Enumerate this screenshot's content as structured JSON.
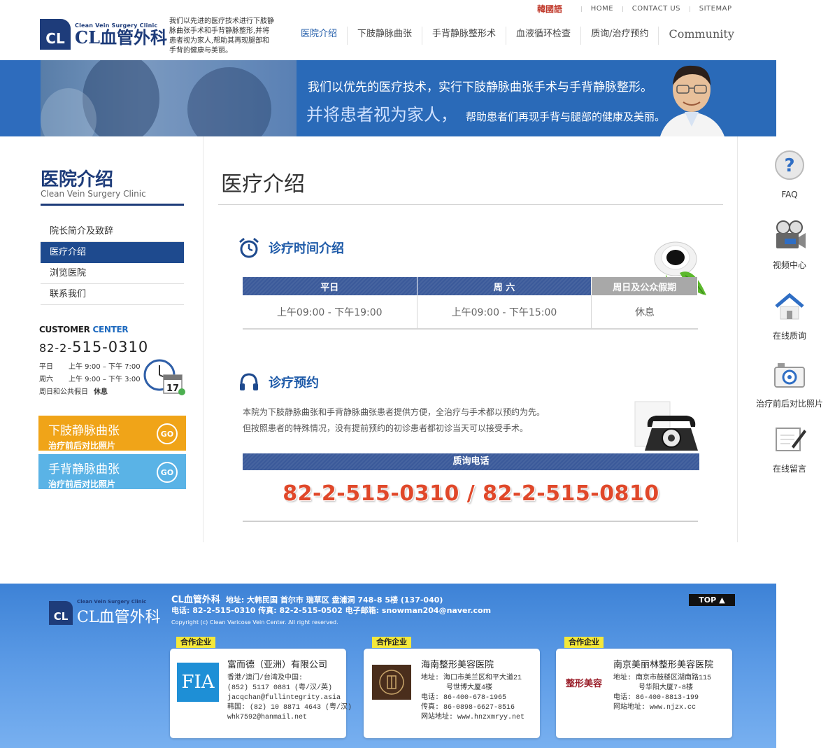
{
  "util": {
    "korean": "韓國語",
    "home": "HOME",
    "contact": "CONTACT US",
    "sitemap": "SITEMAP"
  },
  "logo": {
    "badge": "CL",
    "en": "Clean Vein Surgery Clinic",
    "cn": "CL血管外科",
    "desc": "我们以先进的医疗技术进行下肢静脉曲张手术和手背静脉整形,并将患者视为家人,帮助其再现腿部和手背的健康与美丽。"
  },
  "nav": [
    "医院介绍",
    "下肢静脉曲张",
    "手背静脉整形术",
    "血液循环检查",
    "质询/治疗预约",
    "Community"
  ],
  "banner": {
    "line1": "我们以优先的医疗技术，实行下肢静脉曲张手术与手背静脉整形。",
    "line2_big": "并将患者视为家人，",
    "line2_small": "帮助患者们再现手背与腿部的健康及美丽。"
  },
  "sidebar": {
    "title": "医院介绍",
    "subtitle": "Clean Vein Surgery Clinic",
    "items": [
      "院长简介及致辞",
      "医疗介绍",
      "浏览医院",
      "联系我们"
    ],
    "cc_title_a": "CUSTOMER ",
    "cc_title_b": "CENTER",
    "cc_phone_pre": "82-2-",
    "cc_phone": "515-0310",
    "hours": [
      {
        "k": "平日",
        "v": "上午 9:00 – 下午 7:00"
      },
      {
        "k": "周六",
        "v": "上午 9:00 – 下午 3:00"
      },
      {
        "k": "周日和公共假日",
        "v": "休息"
      }
    ],
    "promo1": {
      "t1": "下肢静脉曲张",
      "t2": "治疗前后对比照片",
      "go": "GO"
    },
    "promo2": {
      "t1": "手背静脉曲张",
      "t2": "治疗前后对比照片",
      "go": "GO"
    }
  },
  "main": {
    "title": "医疗介绍",
    "sec1": "诊疗时间介绍",
    "table": {
      "headers": [
        "平日",
        "周 六",
        "周日及公众假期"
      ],
      "cells": [
        "上午09:00 - 下午19:00",
        "上午09:00 - 下午15:00",
        "休息"
      ]
    },
    "sec2": "诊疗预约",
    "resv1": "本院为下肢静脉曲张和手背静脉曲张患者提供方便，全治疗与手术都以预约为先。",
    "resv2": "但按照患者的特殊情况，没有提前预约的初诊患者都初诊当天可以接受手术。",
    "phone_bar": "质询电话",
    "phones": "82-2-515-0310  /  82-2-515-0810"
  },
  "quick": [
    "FAQ",
    "视频中心",
    "在线质询",
    "治疗前后对比照片",
    "在线留言"
  ],
  "footer": {
    "name": "CL血管外科",
    "addr": "地址: 大韩民国 首尔市 瑞草区 盘浦洞 748-8 5楼 (137-040)",
    "contact": "电话: 82-2-515-0310  传真: 82-2-515-0502  电子邮箱: snowman204@naver.com",
    "copy": "Copyright (c) Clean Varicose Vein Center. All right reserved.",
    "top": "TOP",
    "tag": "合作企业",
    "partners": [
      {
        "logo": "FIA",
        "name": "富而德（亚洲）有限公司",
        "lines": [
          "香港/澳门/台湾及中国:",
          "(852) 5117 0881 (粤/汉/英)",
          "jacqchan@fullintegrity.asia",
          "韩国: (82) 10 8871 4643 (粤/汉)",
          "whk7592@hanmail.net"
        ]
      },
      {
        "logo": "",
        "name": "海南整形美容医院",
        "lines": [
          "地址: 海口市美兰区和平大道21",
          "      号世博大厦4楼",
          "电话: 86-400-678-1965",
          "传真: 86-0898-6627-8516",
          "网站地址: www.hnzxmryy.net"
        ]
      },
      {
        "logo": "整形美容",
        "name": "南京美丽林整形美容医院",
        "lines": [
          "地址: 南京市鼓楼区湖南路115",
          "      号华阳大厦7-8楼",
          "电话: 86-400-8813-199",
          "网站地址: www.njzx.cc"
        ]
      }
    ]
  }
}
